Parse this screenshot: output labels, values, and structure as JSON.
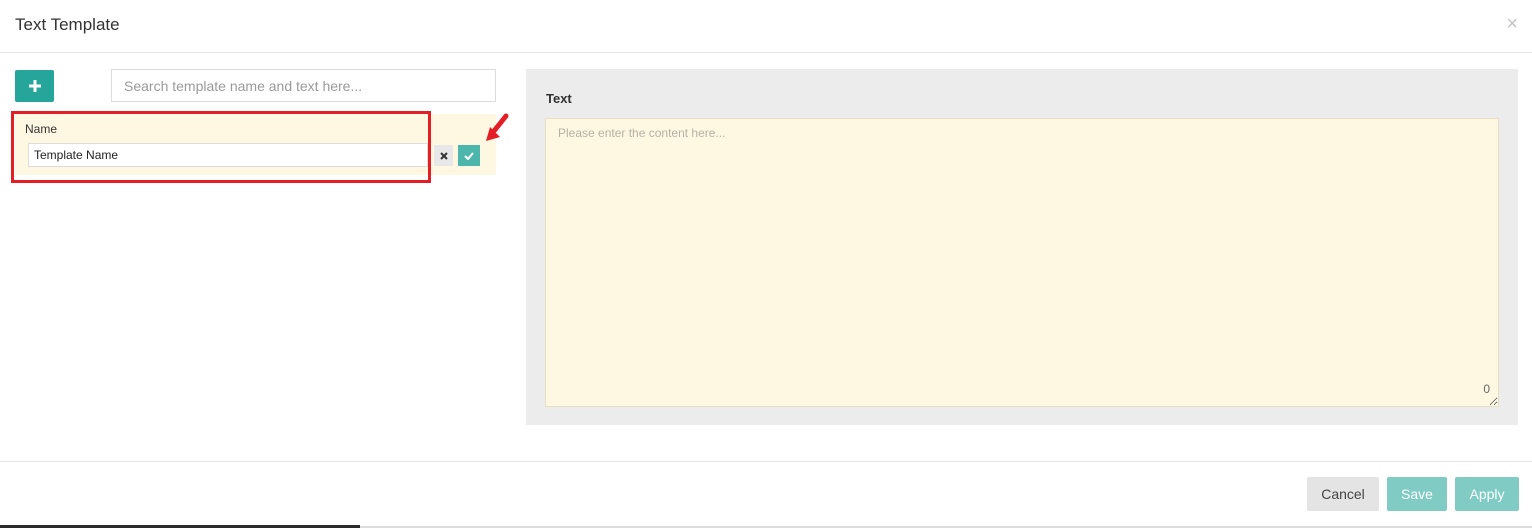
{
  "dialog": {
    "title": "Text Template",
    "close_glyph": "×"
  },
  "left": {
    "add_button_icon": "plus-icon",
    "search_placeholder": "Search template name and text here...",
    "edit": {
      "name_label": "Name",
      "name_value": "Template Name",
      "cancel_icon": "times-icon",
      "confirm_icon": "check-icon"
    }
  },
  "right": {
    "text_label": "Text",
    "content_placeholder": "Please enter the content here...",
    "char_count": "0"
  },
  "footer": {
    "cancel_label": "Cancel",
    "save_label": "Save",
    "apply_label": "Apply"
  },
  "colors": {
    "accent": "#26a69a",
    "accent_light": "#80cbc4",
    "highlight": "#e31e24",
    "edit_bg": "#fef8e3"
  }
}
